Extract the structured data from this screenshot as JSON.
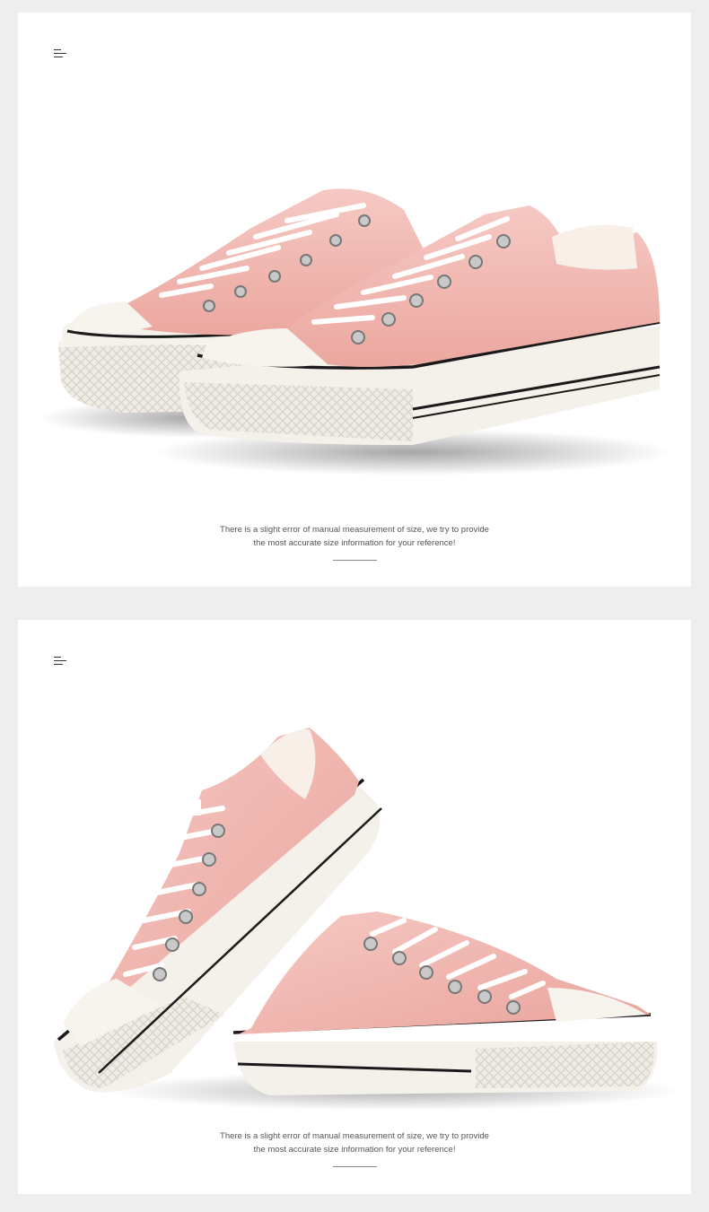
{
  "panels": [
    {
      "menu_icon": "menu-icon",
      "caption_line1": "There is a slight error of manual measurement of size, we try to provide",
      "caption_line2": "the most accurate size information for your reference!"
    },
    {
      "menu_icon": "menu-icon",
      "caption_line1": "There is a slight error of manual measurement of size, we try to provide",
      "caption_line2": "the most accurate size information for your reference!"
    }
  ],
  "colors": {
    "background": "#eeeeee",
    "card": "#ffffff",
    "canvas_pink": "#f2b9b3",
    "sole_white": "#f5f2ec",
    "foxing_black": "#1a1a1a"
  }
}
